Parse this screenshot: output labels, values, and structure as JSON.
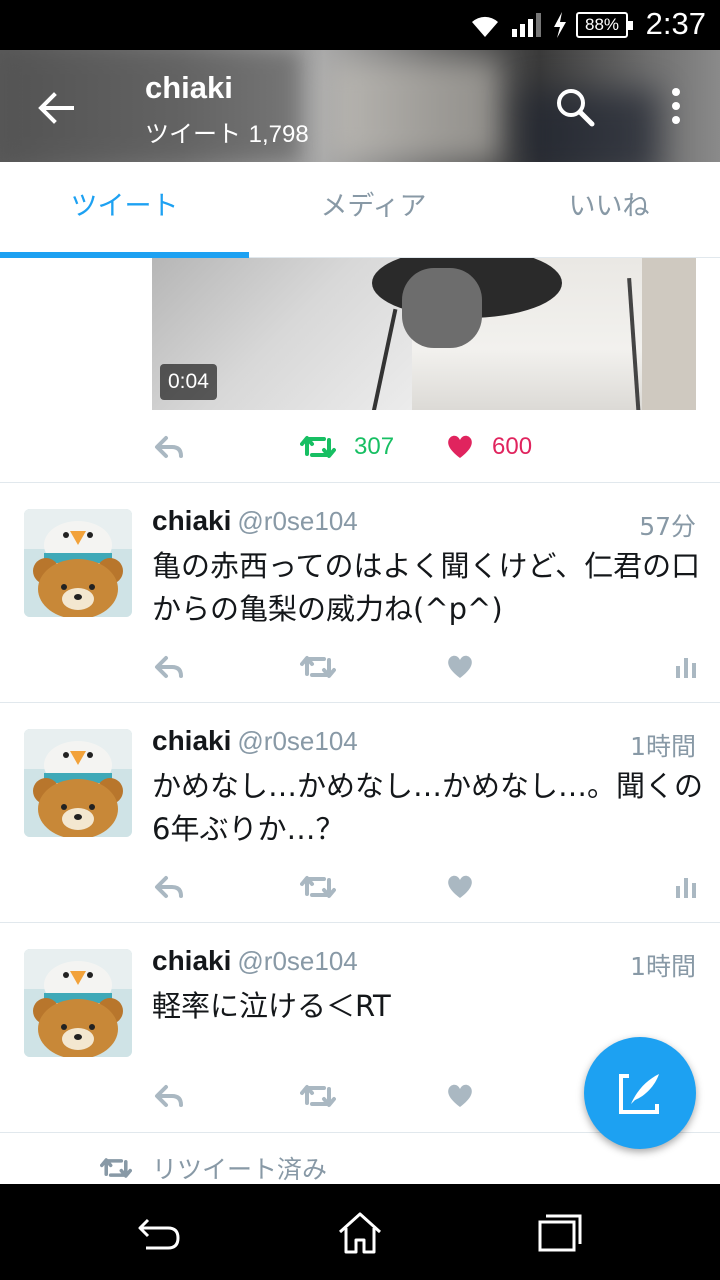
{
  "status_bar": {
    "time": "2:37",
    "battery": "88%",
    "icons": [
      "wifi-icon",
      "signal-icon",
      "charging-icon",
      "battery-icon"
    ]
  },
  "header": {
    "title": "chiaki",
    "subtitle_label": "ツイート",
    "tweet_count": "1,798"
  },
  "tabs": [
    {
      "label": "ツイート",
      "active": true
    },
    {
      "label": "メディア",
      "active": false
    },
    {
      "label": "いいね",
      "active": false
    }
  ],
  "top_tweet": {
    "video_duration": "0:04",
    "retweet_count": "307",
    "like_count": "600"
  },
  "tweets": [
    {
      "name": "chiaki",
      "handle": "@r0se104",
      "time": "57分",
      "text": "亀の赤西ってのはよく聞くけど、仁君の口からの亀梨の威力ね(^p^)"
    },
    {
      "name": "chiaki",
      "handle": "@r0se104",
      "time": "1時間",
      "text": "かめなし…かめなし…かめなし…。聞くの6年ぶりか…？"
    },
    {
      "name": "chiaki",
      "handle": "@r0se104",
      "time": "1時間",
      "text": "軽率に泣ける＜RT"
    }
  ],
  "retweeted_label": "リツイート済み",
  "colors": {
    "accent": "#1da1f2",
    "retweet_green": "#17bf63",
    "like_red": "#e0245e",
    "muted": "#8899a6"
  }
}
